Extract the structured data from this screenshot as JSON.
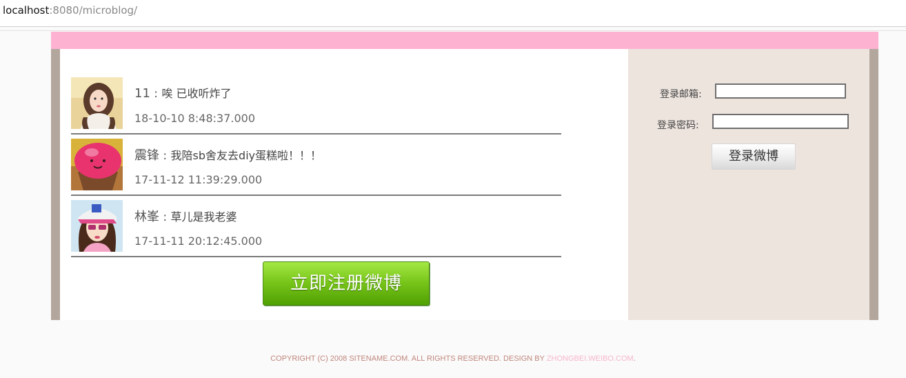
{
  "browser": {
    "url_host": "localhost",
    "url_rest": ":8080/microblog/"
  },
  "posts": [
    {
      "author": "11",
      "separator": " : ",
      "content": "唉 已收听炸了",
      "time": "18-10-10 8:48:37.000",
      "avatar_icon": "girl-photo-avatar"
    },
    {
      "author": "震锋",
      "separator": " : ",
      "content": "我陪sb舍友去diy蛋糕啦！！！",
      "time": "17-11-12 11:39:29.000",
      "avatar_icon": "pink-cupcake-avatar"
    },
    {
      "author": "林峯",
      "separator": " : ",
      "content": "草儿是我老婆",
      "time": "17-11-11 20:12:45.000",
      "avatar_icon": "cartoon-girl-avatar"
    }
  ],
  "register_button": "立即注册微博",
  "login": {
    "email_label": "登录邮箱:",
    "password_label": "登录密码:",
    "email_value": "",
    "password_value": "",
    "button": "登录微博"
  },
  "footer": {
    "text": "COPYRIGHT (C) 2008 SITENAME.COM. ALL RIGHTS RESERVED. DESIGN BY ",
    "link": "ZHONGBEI.WEIBO.COM",
    "end": "."
  },
  "colors": {
    "pink_bar": "#fdb2d1",
    "side_panel": "#ede4de",
    "frame": "#b3a79d",
    "register_green": "#76c318"
  }
}
